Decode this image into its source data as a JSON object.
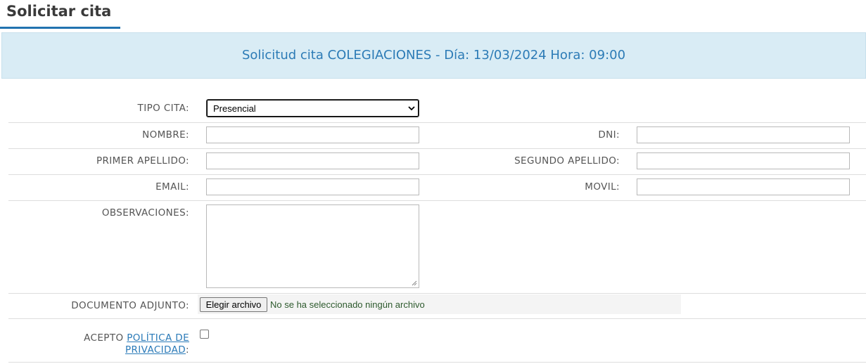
{
  "page": {
    "title": "Solicitar cita"
  },
  "banner": {
    "text": "Solicitud cita COLEGIACIONES - Día: 13/03/2024 Hora: 09:00"
  },
  "form": {
    "tipo_cita": {
      "label": "TIPO CITA:",
      "value": "Presencial"
    },
    "nombre": {
      "label": "NOMBRE:",
      "value": ""
    },
    "dni": {
      "label": "DNI:",
      "value": ""
    },
    "primer_apellido": {
      "label": "PRIMER APELLIDO:",
      "value": ""
    },
    "segundo_apellido": {
      "label": "SEGUNDO APELLIDO:",
      "value": ""
    },
    "email": {
      "label": "EMAIL:",
      "value": ""
    },
    "movil": {
      "label": "MOVIL:",
      "value": ""
    },
    "observaciones": {
      "label": "OBSERVACIONES:",
      "value": ""
    },
    "documento": {
      "label": "DOCUMENTO ADJUNTO:",
      "button": "Elegir archivo",
      "status": "No se ha seleccionado ningún archivo"
    },
    "privacidad": {
      "prefix": "ACEPTO ",
      "link_line1": "POLÍTICA DE",
      "link_line2": "PRIVACIDAD",
      "suffix": ":",
      "checked": false
    }
  },
  "colors": {
    "accent": "#2273b0",
    "banner_bg": "#d9ecf5",
    "banner_text": "#2c7bb6",
    "link": "#2a7ab8"
  }
}
